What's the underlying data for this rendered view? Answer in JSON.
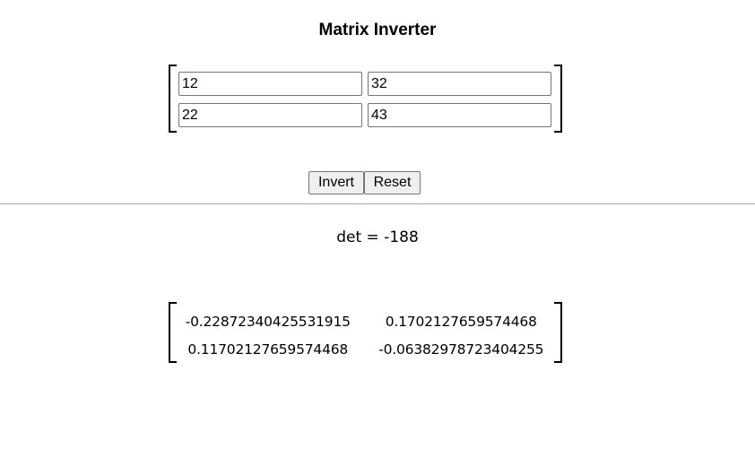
{
  "title": "Matrix Inverter",
  "input_matrix": [
    [
      "12",
      "32"
    ],
    [
      "22",
      "43"
    ]
  ],
  "buttons": {
    "invert": "Invert",
    "reset": "Reset"
  },
  "det_label": "det = -188",
  "inverse_matrix": [
    [
      "-0.22872340425531915",
      "0.1702127659574468"
    ],
    [
      "0.11702127659574468",
      "-0.06382978723404255"
    ]
  ]
}
